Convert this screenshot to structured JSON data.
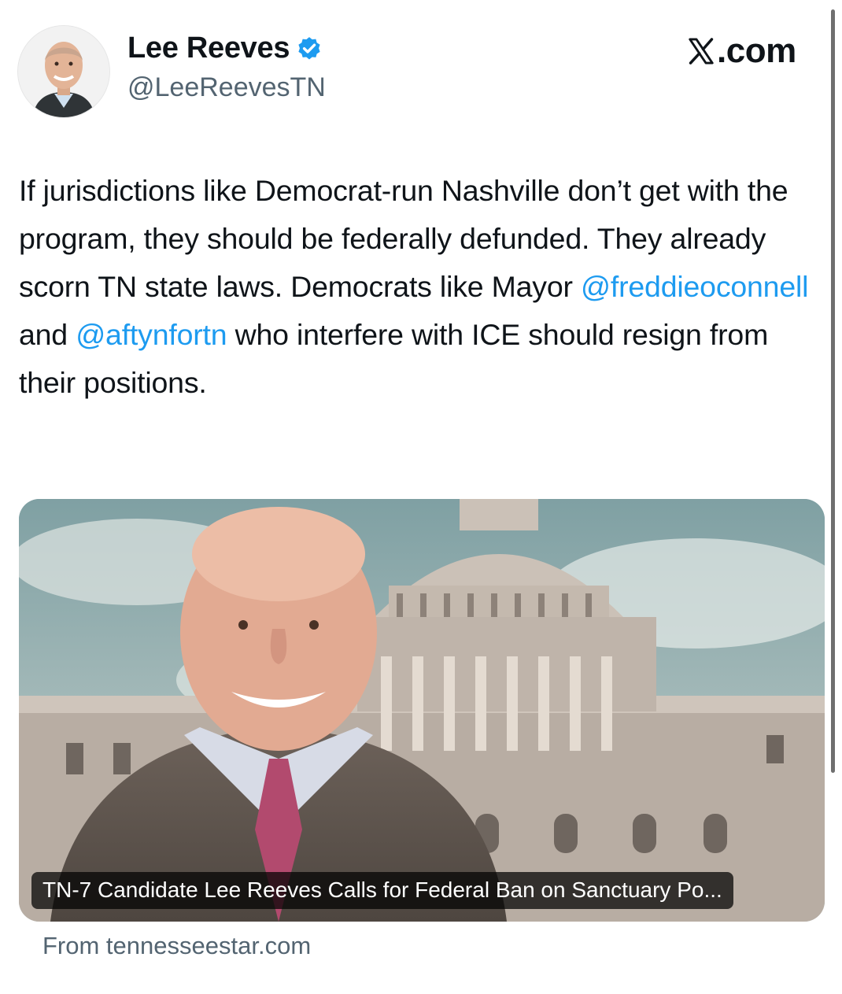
{
  "author": {
    "display_name": "Lee Reeves",
    "handle": "@LeeReevesTN",
    "verified_icon": "verified-badge-icon",
    "verified_color": "#1d9bf0"
  },
  "brand": {
    "suffix": ".com",
    "logo_icon": "x-logo-icon"
  },
  "tweet": {
    "text_part1": "If jurisdictions like Democrat-run Nashville don’t get with the program, they should be federally defunded. They already scorn TN state laws. Democrats like Mayor ",
    "mention1": "@freddieoconnell",
    "text_part2": " and ",
    "mention2": "@aftynfortn",
    "text_part3": " who interfere with ICE should resign from their positions.",
    "mention_color": "#1d9bf0"
  },
  "link_card": {
    "title": "TN-7 Candidate Lee Reeves Calls for Federal Ban on Sanctuary Po...",
    "image_icon": "capitol-portrait-image"
  },
  "source": {
    "label": "From tennesseestar.com"
  }
}
